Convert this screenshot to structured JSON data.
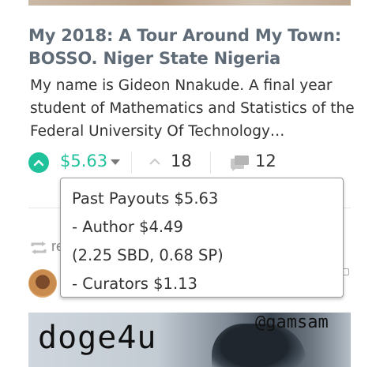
{
  "post": {
    "title": "My 2018: A Tour Around My Town: BOSSO. Niger State Nigeria",
    "excerpt": "My name is Gideon Nnakude. A final year student of Mathematics and Statistics of the Federal University Of Technology…"
  },
  "actions": {
    "payout": "$5.63",
    "votes": "18",
    "comments": "12"
  },
  "colors": {
    "accent": "#1fc29b"
  },
  "payout_popup": {
    "lines": [
      "Past Payouts $5.63",
      "- Author $4.49",
      "(2.25 SBD, 0.68 SP)",
      "- Curators $1.13"
    ]
  },
  "reblog": {
    "text": "re"
  },
  "banner": {
    "title": "doge4u",
    "handle": "@gamsam"
  },
  "icons": [
    "upvote-icon",
    "caret-down-icon",
    "chevron-up-icon",
    "comments-icon",
    "reblog-icon"
  ]
}
